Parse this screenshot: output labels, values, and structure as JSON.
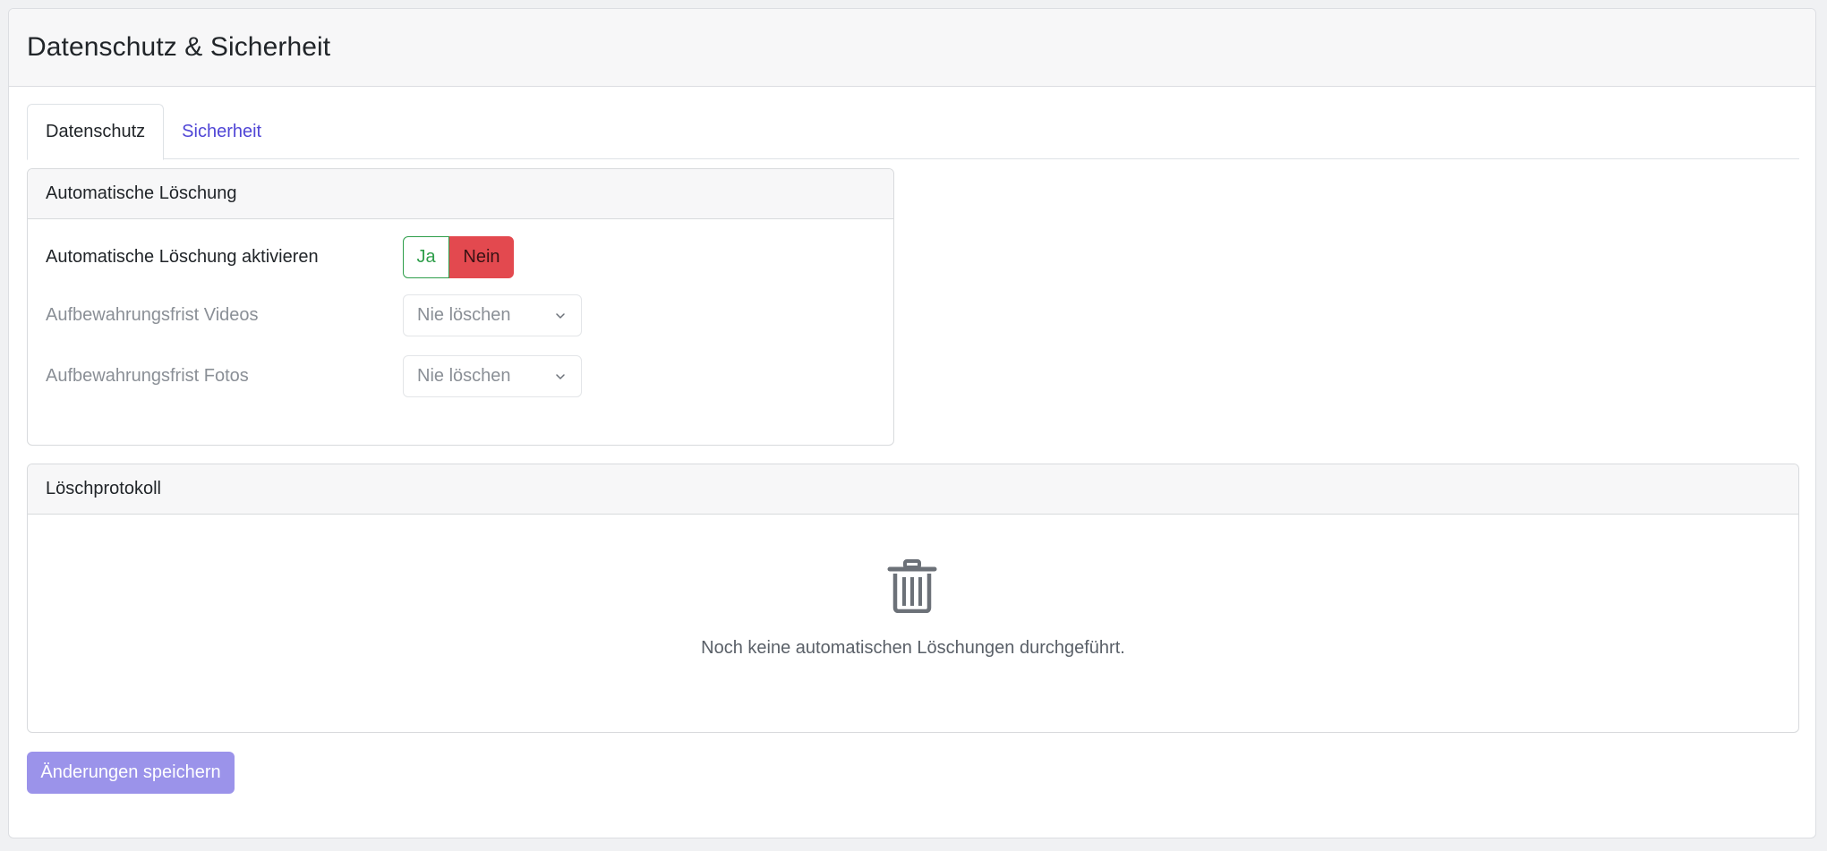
{
  "page": {
    "title": "Datenschutz & Sicherheit"
  },
  "tabs": [
    {
      "label": "Datenschutz",
      "active": true
    },
    {
      "label": "Sicherheit",
      "active": false
    }
  ],
  "auto_delete": {
    "header": "Automatische Löschung",
    "enable": {
      "label": "Automatische Löschung aktivieren",
      "yes_label": "Ja",
      "no_label": "Nein",
      "selected": "Nein"
    },
    "videos": {
      "label": "Aufbewahrungsfrist Videos",
      "value": "Nie löschen"
    },
    "photos": {
      "label": "Aufbewahrungsfrist Fotos",
      "value": "Nie löschen"
    }
  },
  "log": {
    "header": "Löschprotokoll",
    "empty_icon": "trash-icon",
    "empty_text": "Noch keine automatischen Löschungen durchgeführt."
  },
  "actions": {
    "save_label": "Änderungen speichern"
  },
  "colors": {
    "accent": "#5046d6",
    "save_button": "#9b93ea",
    "yes": "#2e9e4a",
    "no": "#e3494f"
  }
}
